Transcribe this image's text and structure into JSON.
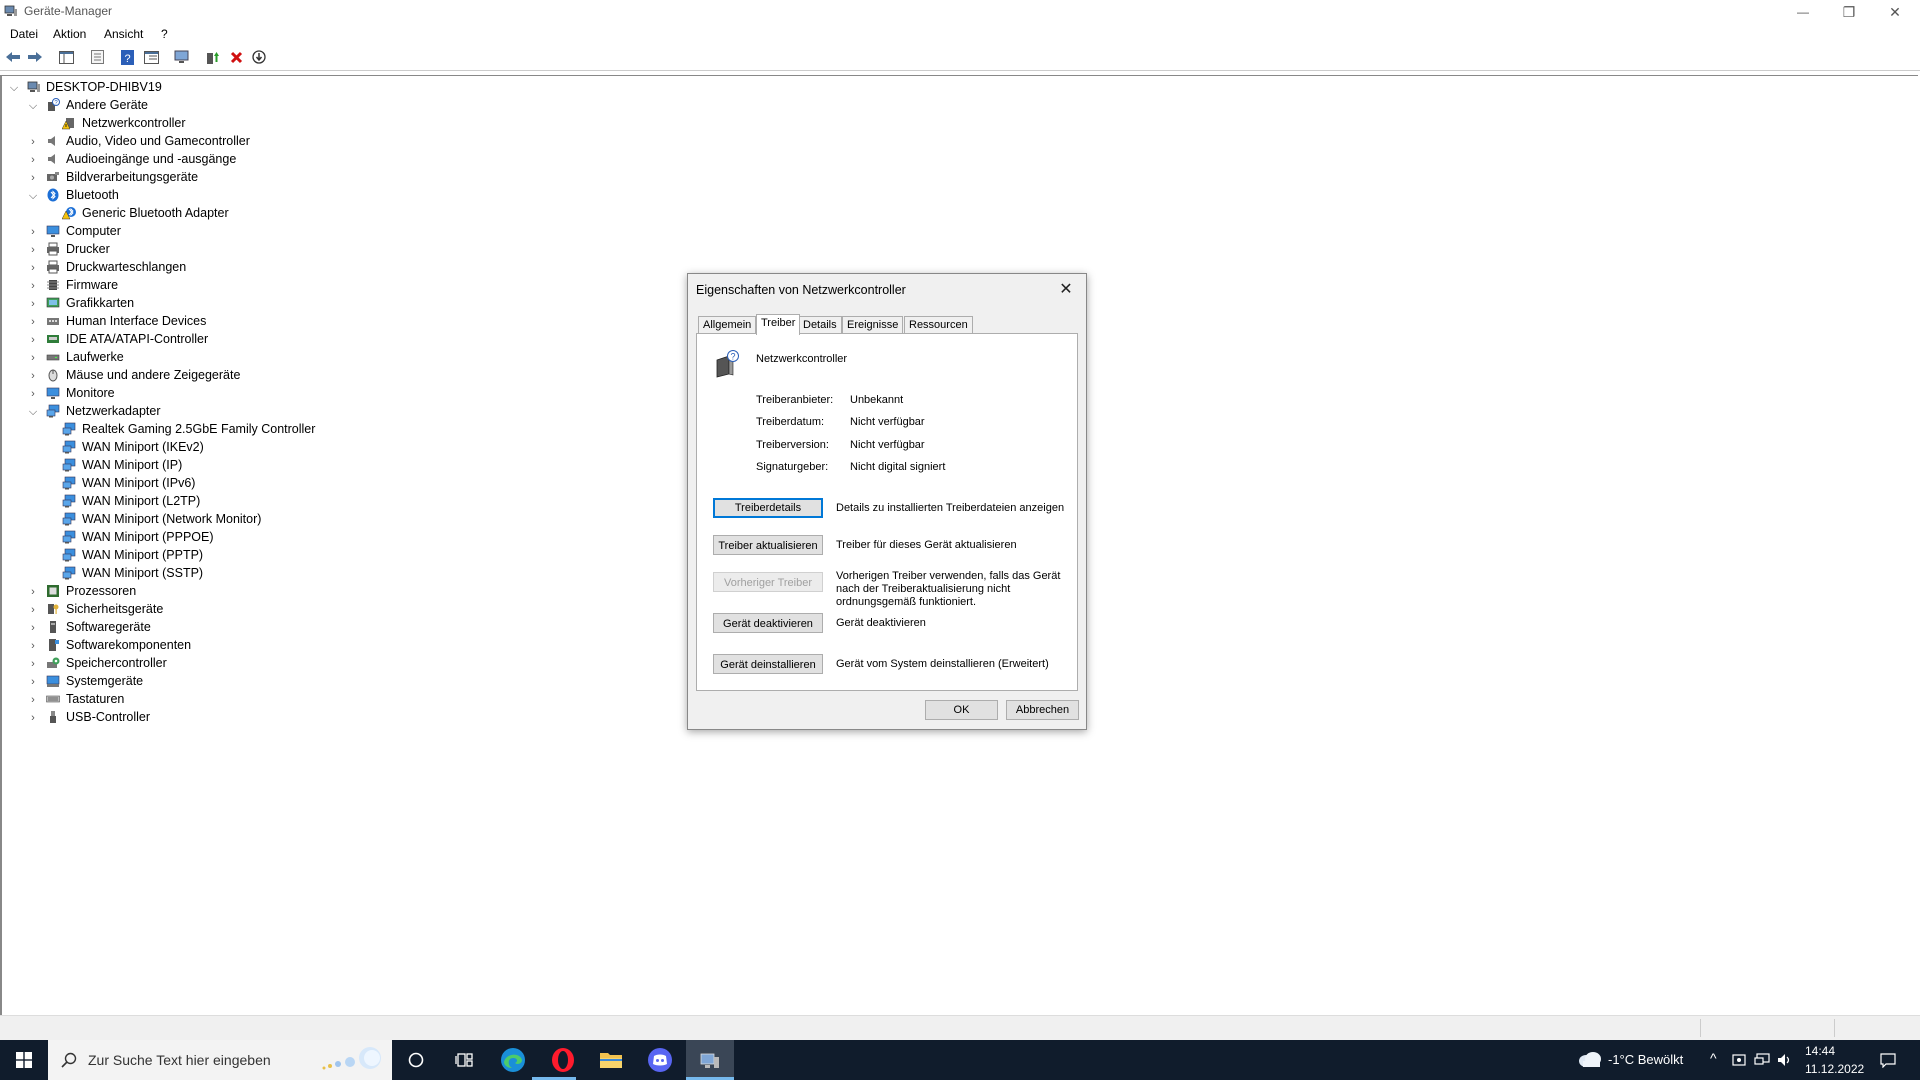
{
  "window": {
    "title": "Geräte-Manager",
    "minimize": "—",
    "restore": "❐",
    "close": "✕"
  },
  "menu": [
    {
      "label": "Datei"
    },
    {
      "label": "Aktion"
    },
    {
      "label": "Ansicht"
    },
    {
      "label": "?"
    }
  ],
  "tree": {
    "root": "DESKTOP-DHIBV19",
    "items": [
      {
        "label": "Andere Geräte",
        "level": 1,
        "expanded": true,
        "icon": "unknown-device-icon"
      },
      {
        "label": "Netzwerkcontroller",
        "level": 2,
        "icon": "warning-device-icon"
      },
      {
        "label": "Audio, Video und Gamecontroller",
        "level": 1,
        "icon": "speaker-icon"
      },
      {
        "label": "Audioeingänge und -ausgänge",
        "level": 1,
        "icon": "speaker-icon"
      },
      {
        "label": "Bildverarbeitungsgeräte",
        "level": 1,
        "icon": "camera-icon"
      },
      {
        "label": "Bluetooth",
        "level": 1,
        "expanded": true,
        "icon": "bluetooth-icon"
      },
      {
        "label": "Generic Bluetooth Adapter",
        "level": 2,
        "icon": "warning-bluetooth-icon"
      },
      {
        "label": "Computer",
        "level": 1,
        "icon": "monitor-icon"
      },
      {
        "label": "Drucker",
        "level": 1,
        "icon": "printer-icon"
      },
      {
        "label": "Druckwarteschlangen",
        "level": 1,
        "icon": "printer-icon"
      },
      {
        "label": "Firmware",
        "level": 1,
        "icon": "chip-icon"
      },
      {
        "label": "Grafikkarten",
        "level": 1,
        "icon": "display-adapter-icon"
      },
      {
        "label": "Human Interface Devices",
        "level": 1,
        "icon": "hid-icon"
      },
      {
        "label": "IDE ATA/ATAPI-Controller",
        "level": 1,
        "icon": "ide-controller-icon"
      },
      {
        "label": "Laufwerke",
        "level": 1,
        "icon": "disk-drive-icon"
      },
      {
        "label": "Mäuse und andere Zeigegeräte",
        "level": 1,
        "icon": "mouse-icon"
      },
      {
        "label": "Monitore",
        "level": 1,
        "icon": "monitor-icon"
      },
      {
        "label": "Netzwerkadapter",
        "level": 1,
        "expanded": true,
        "icon": "network-adapter-icon"
      },
      {
        "label": "Realtek Gaming 2.5GbE Family Controller",
        "level": 2,
        "icon": "network-adapter-icon"
      },
      {
        "label": "WAN Miniport (IKEv2)",
        "level": 2,
        "icon": "network-adapter-icon"
      },
      {
        "label": "WAN Miniport (IP)",
        "level": 2,
        "icon": "network-adapter-icon"
      },
      {
        "label": "WAN Miniport (IPv6)",
        "level": 2,
        "icon": "network-adapter-icon"
      },
      {
        "label": "WAN Miniport (L2TP)",
        "level": 2,
        "icon": "network-adapter-icon"
      },
      {
        "label": "WAN Miniport (Network Monitor)",
        "level": 2,
        "icon": "network-adapter-icon"
      },
      {
        "label": "WAN Miniport (PPPOE)",
        "level": 2,
        "icon": "network-adapter-icon"
      },
      {
        "label": "WAN Miniport (PPTP)",
        "level": 2,
        "icon": "network-adapter-icon"
      },
      {
        "label": "WAN Miniport (SSTP)",
        "level": 2,
        "icon": "network-adapter-icon"
      },
      {
        "label": "Prozessoren",
        "level": 1,
        "icon": "processor-icon"
      },
      {
        "label": "Sicherheitsgeräte",
        "level": 1,
        "icon": "security-device-icon"
      },
      {
        "label": "Softwaregeräte",
        "level": 1,
        "icon": "software-device-icon"
      },
      {
        "label": "Softwarekomponenten",
        "level": 1,
        "icon": "software-component-icon"
      },
      {
        "label": "Speichercontroller",
        "level": 1,
        "icon": "storage-controller-icon"
      },
      {
        "label": "Systemgeräte",
        "level": 1,
        "icon": "system-device-icon"
      },
      {
        "label": "Tastaturen",
        "level": 1,
        "icon": "keyboard-icon"
      },
      {
        "label": "USB-Controller",
        "level": 1,
        "icon": "usb-icon"
      }
    ]
  },
  "dialog": {
    "title": "Eigenschaften von Netzwerkcontroller",
    "close": "✕",
    "tabs": [
      "Allgemein",
      "Treiber",
      "Details",
      "Ereignisse",
      "Ressourcen"
    ],
    "active_tab": "Treiber",
    "device_name": "Netzwerkcontroller",
    "properties": [
      {
        "label": "Treiberanbieter:",
        "value": "Unbekannt"
      },
      {
        "label": "Treiberdatum:",
        "value": "Nicht verfügbar"
      },
      {
        "label": "Treiberversion:",
        "value": "Nicht verfügbar"
      },
      {
        "label": "Signaturgeber:",
        "value": "Nicht digital signiert"
      }
    ],
    "actions": [
      {
        "button": "Treiberdetails",
        "desc": "Details zu installierten Treiberdateien anzeigen"
      },
      {
        "button": "Treiber aktualisieren",
        "desc": "Treiber für dieses Gerät aktualisieren"
      },
      {
        "button": "Vorheriger Treiber",
        "desc": "Vorherigen Treiber verwenden, falls das Gerät nach der Treiberaktualisierung nicht ordnungsgemäß funktioniert.",
        "disabled": true
      },
      {
        "button": "Gerät deaktivieren",
        "desc": "Gerät deaktivieren"
      },
      {
        "button": "Gerät deinstallieren",
        "desc": "Gerät vom System deinstallieren (Erweitert)"
      }
    ],
    "ok": "OK",
    "cancel": "Abbrechen"
  },
  "taskbar": {
    "search_placeholder": "Zur Suche Text hier eingeben",
    "weather": "-1°C  Bewölkt",
    "time": "14:44",
    "date": "11.12.2022"
  }
}
